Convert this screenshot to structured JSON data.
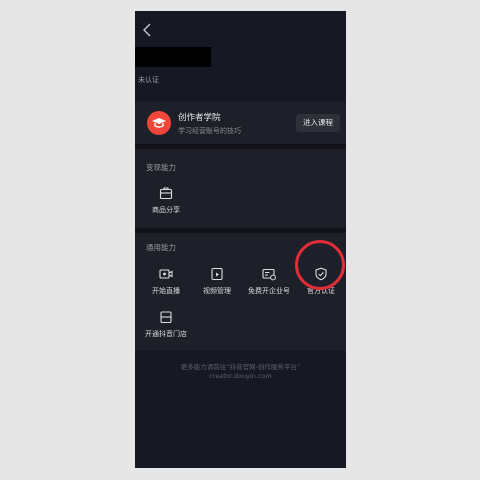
{
  "profile": {
    "status_text": "未认证"
  },
  "academy": {
    "title": "创作者学院",
    "subtitle": "学习经营账号的技巧",
    "enter_button": "进入课程"
  },
  "monetize": {
    "section_title": "变现能力",
    "items": [
      {
        "label": "商品分享",
        "icon": "bag-icon"
      }
    ]
  },
  "general": {
    "section_title": "通用能力",
    "items": [
      {
        "label": "开始直播",
        "icon": "live-camera-icon"
      },
      {
        "label": "视频管理",
        "icon": "video-manage-icon"
      },
      {
        "label": "免费开企业号",
        "icon": "enterprise-card-icon"
      },
      {
        "label": "官方认证",
        "icon": "shield-check-icon"
      },
      {
        "label": "开通抖音门店",
        "icon": "store-icon"
      }
    ]
  },
  "footer": {
    "line1": "更多能力请前往“抖音官网-创作服务平台”",
    "line2": "creator.douyin.com"
  },
  "colors": {
    "background": "#161823",
    "card": "#1e2029",
    "accent": "#f0473a",
    "highlight": "#e02d38"
  }
}
